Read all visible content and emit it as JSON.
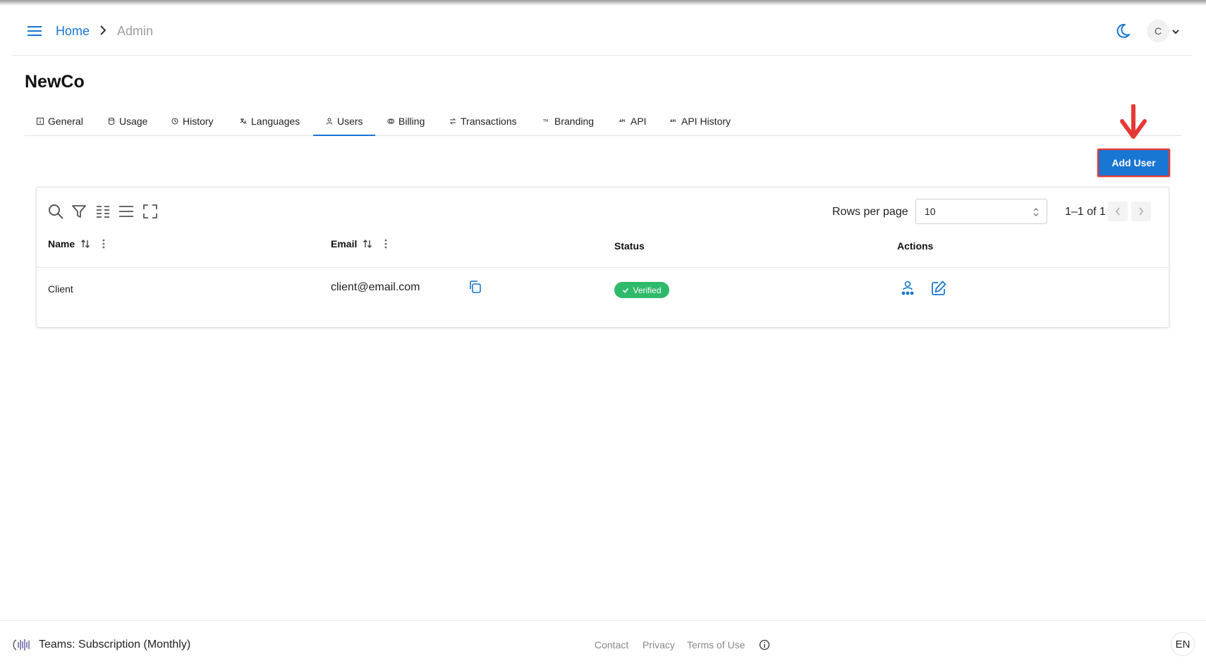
{
  "header": {
    "breadcrumb": {
      "home": "Home",
      "current": "Admin"
    },
    "avatar_initial": "C",
    "icons": [
      "menu-icon",
      "chevron-right-icon",
      "moon-icon",
      "chevron-down-icon"
    ]
  },
  "page": {
    "title": "NewCo"
  },
  "tabs": [
    {
      "label": "General",
      "icon": "info-box-icon"
    },
    {
      "label": "Usage",
      "icon": "database-icon"
    },
    {
      "label": "History",
      "icon": "history-icon"
    },
    {
      "label": "Languages",
      "icon": "translate-icon"
    },
    {
      "label": "Users",
      "icon": "user-icon",
      "active": true
    },
    {
      "label": "Billing",
      "icon": "coins-icon"
    },
    {
      "label": "Transactions",
      "icon": "transfer-icon"
    },
    {
      "label": "Branding",
      "icon": "trademark-icon"
    },
    {
      "label": "API",
      "icon": "api-icon"
    },
    {
      "label": "API History",
      "icon": "api-history-icon"
    }
  ],
  "actions": {
    "add_user": "Add User"
  },
  "table": {
    "rows_per_page_label": "Rows per page",
    "rows_per_page_value": "10",
    "page_info": "1–1 of 1",
    "columns": {
      "name": "Name",
      "email": "Email",
      "status": "Status",
      "actions": "Actions"
    },
    "rows": [
      {
        "name": "Client",
        "email": "client@email.com",
        "status": "Verified"
      }
    ]
  },
  "footer": {
    "plan": "Teams: Subscription (Monthly)",
    "links": [
      "Contact",
      "Privacy",
      "Terms of Use"
    ],
    "language": "EN"
  },
  "colors": {
    "primary": "#1976d2",
    "verified": "#2fb96b",
    "highlight": "#e53935"
  }
}
